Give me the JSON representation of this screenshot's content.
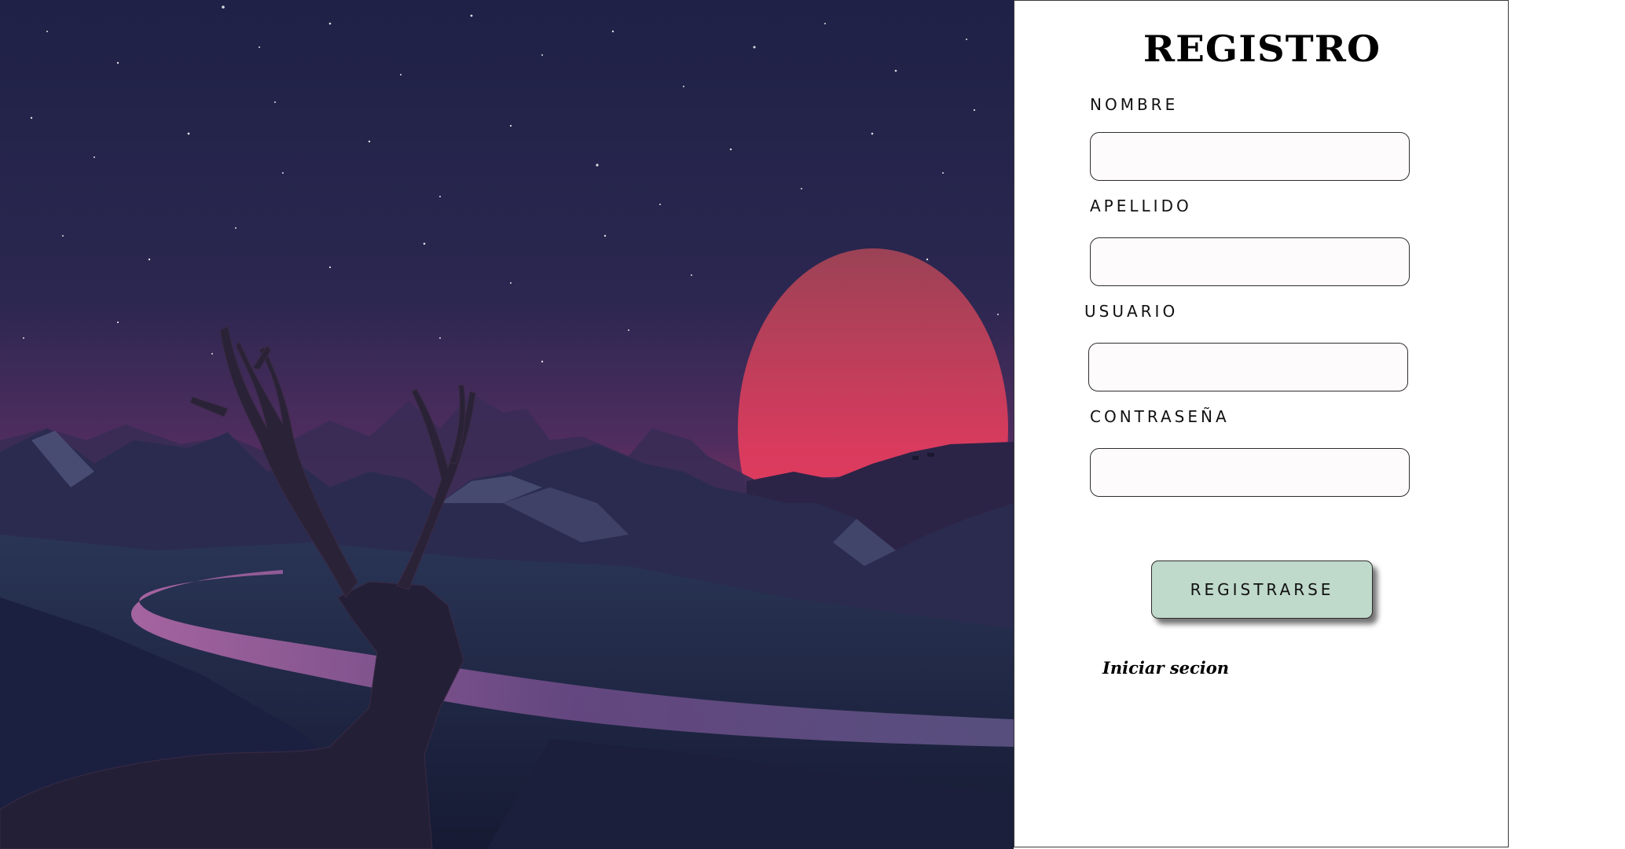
{
  "form": {
    "title": "REGISTRO",
    "fields": [
      {
        "label": "NOMBRE",
        "value": "",
        "placeholder": ""
      },
      {
        "label": "APELLIDO",
        "value": "",
        "placeholder": ""
      },
      {
        "label": "USUARIO",
        "value": "",
        "placeholder": ""
      },
      {
        "label": "CONTRASEÑA",
        "value": "",
        "placeholder": ""
      }
    ],
    "submit_label": "REGISTRARSE",
    "login_link": "Iniciar secion"
  },
  "colors": {
    "button_background": "#bfd9cb",
    "panel_background": "#ffffff",
    "sky_top": "#1f2146",
    "sky_horizon": "#5a2f63",
    "moon": "#e8395f"
  }
}
